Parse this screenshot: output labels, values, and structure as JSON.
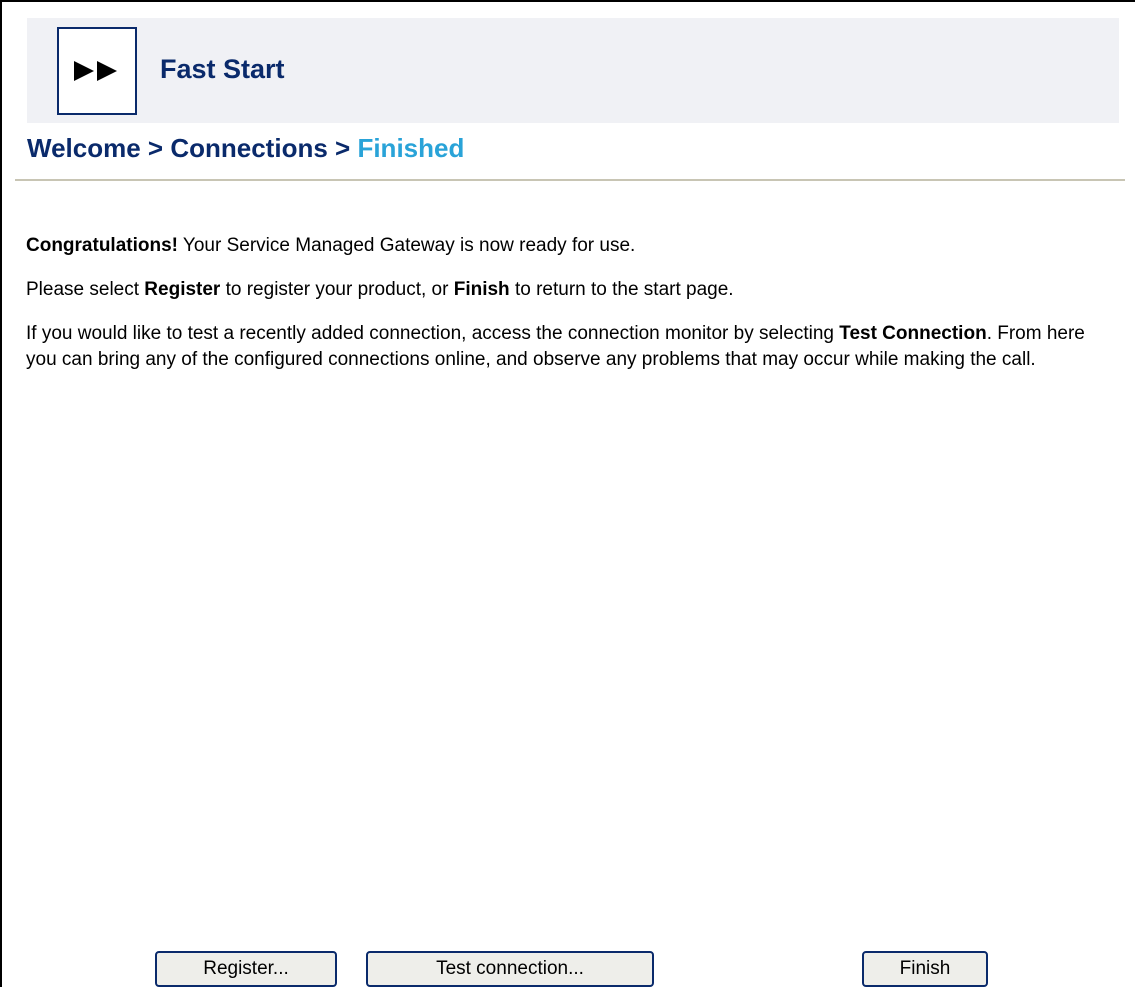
{
  "header": {
    "title": "Fast Start",
    "logo_icon": "fast-forward-icon"
  },
  "breadcrumb": {
    "step1": "Welcome",
    "sep": ">",
    "step2": "Connections",
    "current": "Finished"
  },
  "body": {
    "p1_bold": "Congratulations!",
    "p1_text": " Your Service Managed Gateway is now ready for use.",
    "p2_pre": "Please select ",
    "p2_b1": "Register",
    "p2_mid": " to register your product, or ",
    "p2_b2": "Finish",
    "p2_post": " to return to the start page.",
    "p3_pre": "If you would like to test a recently added connection, access the connection monitor by selecting ",
    "p3_bold": "Test Connection",
    "p3_post": ". From here you can bring any of the configured connections online, and observe any problems that may occur while making the call."
  },
  "buttons": {
    "register": "Register...",
    "test": "Test connection...",
    "finish": "Finish"
  },
  "colors": {
    "brand_navy": "#0a2a6b",
    "current_step": "#29a3d8",
    "header_bg": "#f0f1f5"
  }
}
